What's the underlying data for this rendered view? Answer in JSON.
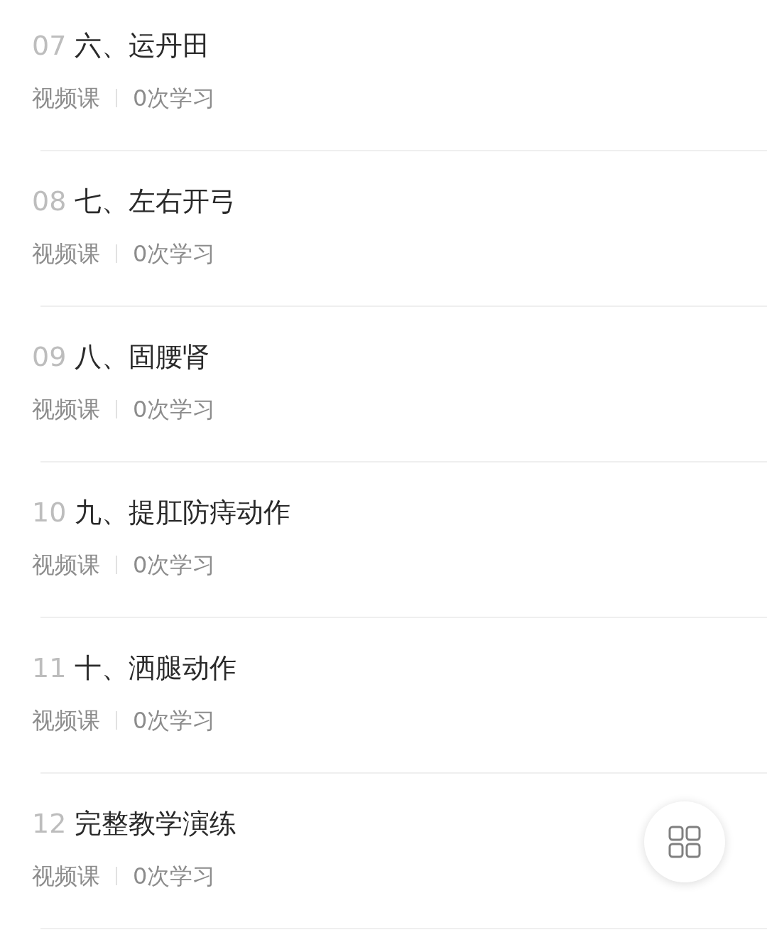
{
  "lessons": [
    {
      "number": "07",
      "title": "六、运丹田",
      "type": "视频课",
      "study_count": "0次学习"
    },
    {
      "number": "08",
      "title": "七、左右开弓",
      "type": "视频课",
      "study_count": "0次学习"
    },
    {
      "number": "09",
      "title": "八、固腰肾",
      "type": "视频课",
      "study_count": "0次学习"
    },
    {
      "number": "10",
      "title": "九、提肛防痔动作",
      "type": "视频课",
      "study_count": "0次学习"
    },
    {
      "number": "11",
      "title": "十、洒腿动作",
      "type": "视频课",
      "study_count": "0次学习"
    },
    {
      "number": "12",
      "title": "完整教学演练",
      "type": "视频课",
      "study_count": "0次学习"
    }
  ]
}
